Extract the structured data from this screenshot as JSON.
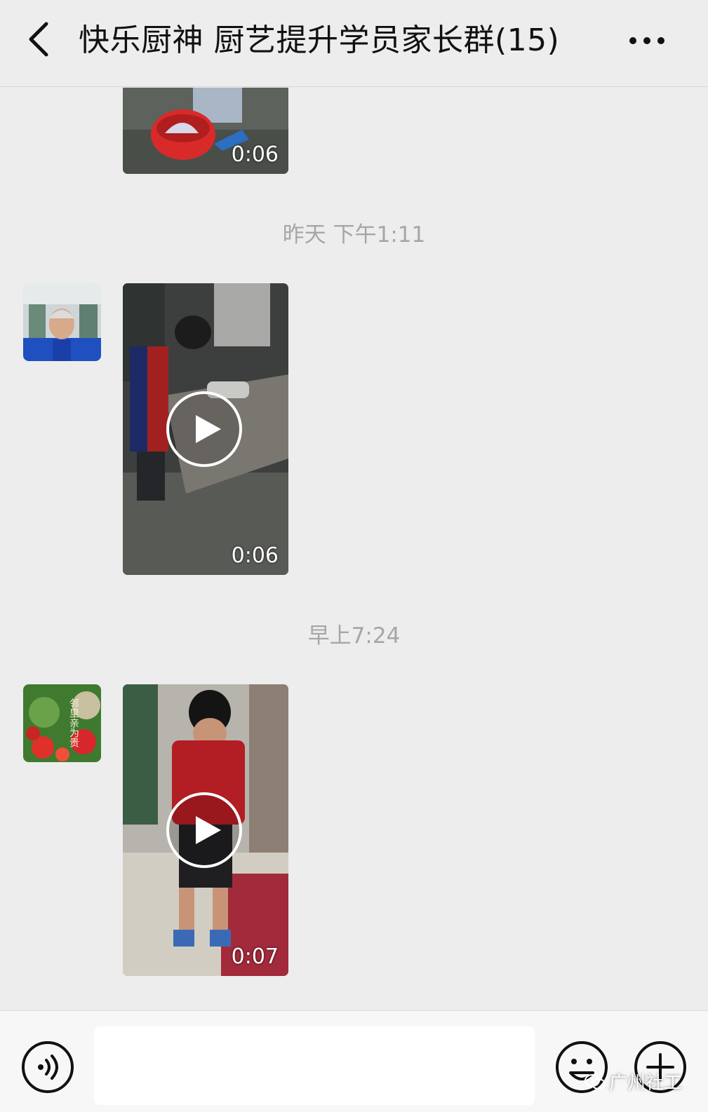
{
  "header": {
    "back_icon": "chevron-left-icon",
    "title": "快乐厨神 厨艺提升学员家长群(15)",
    "more_icon": "more-dots-icon"
  },
  "messages": [
    {
      "type": "video",
      "duration": "0:06",
      "partial": true
    },
    {
      "type": "timestamp",
      "text": "昨天 下午1:11"
    },
    {
      "type": "video",
      "duration": "0:06",
      "play_icon": "play-icon"
    },
    {
      "type": "timestamp",
      "text": "早上7:24"
    },
    {
      "type": "video",
      "duration": "0:07",
      "play_icon": "play-icon",
      "avatar_text": "邻里亲为贵"
    }
  ],
  "footer": {
    "voice_icon": "voice-icon",
    "input_value": "",
    "emoji_icon": "emoji-icon",
    "plus_icon": "plus-icon"
  },
  "watermark": {
    "text": "广州社工"
  },
  "colors": {
    "background": "#ededed",
    "timestamp": "#a6a6a6",
    "bar": "#f7f7f7"
  }
}
